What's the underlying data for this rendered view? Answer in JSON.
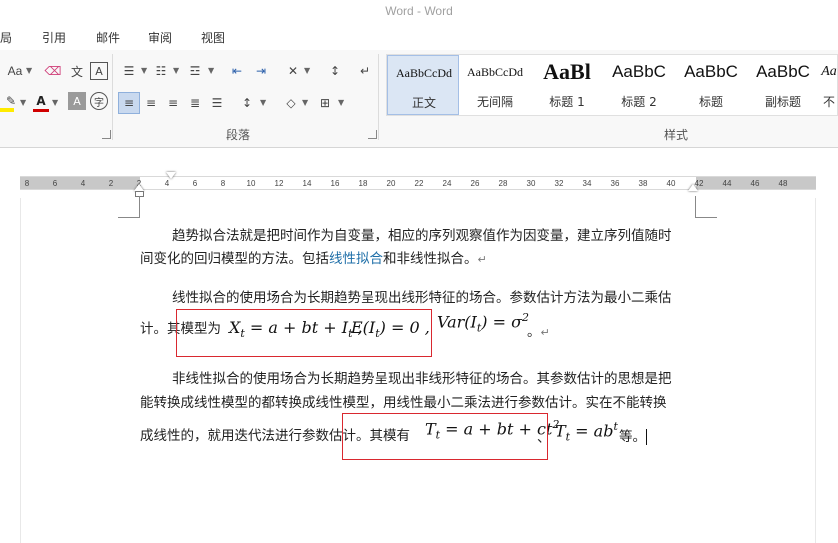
{
  "window": {
    "title": "Word - Word"
  },
  "menu_tabs": [
    "局",
    "引用",
    "邮件",
    "审阅",
    "视图"
  ],
  "ribbon": {
    "groups": {
      "paragraph": "段落",
      "styles": "样式"
    },
    "font_size_button": "Aa",
    "styles": [
      {
        "sample": "AaBbCcDd",
        "name": "正文",
        "selected": true
      },
      {
        "sample": "AaBbCcDd",
        "name": "无间隔"
      },
      {
        "sample": "AaBl",
        "name": "标题 1"
      },
      {
        "sample": "AaBbC",
        "name": "标题 2"
      },
      {
        "sample": "AaBbC",
        "name": "标题"
      },
      {
        "sample": "AaBbC",
        "name": "副标题"
      },
      {
        "sample": "Aa",
        "name": "不"
      }
    ]
  },
  "ruler": {
    "ticks": [
      "8",
      "6",
      "4",
      "2",
      "2",
      "4",
      "6",
      "8",
      "10",
      "12",
      "14",
      "16",
      "18",
      "20",
      "22",
      "24",
      "26",
      "28",
      "30",
      "32",
      "34",
      "36",
      "38",
      "40",
      "42",
      "44",
      "46",
      "48"
    ]
  },
  "document": {
    "p1": {
      "line1": "趋势拟合法就是把时间作为自变量，相应的序列观察值作为因变量，建立序列值随时",
      "line2a": "间变化的回归模型的方法。包括",
      "link": "线性拟合",
      "line2b": "和非线性拟合。"
    },
    "p2": {
      "line1": "线性拟合的使用场合为长期趋势呈现出线形特征的场合。参数估计方法为最小二乘估",
      "line2a": "计。其模型为",
      "eq1": "Xt = a + bt + It",
      "eq2": "E(It) = 0",
      "eq3": "Var(It) = σ2",
      "line2b": "。"
    },
    "p3": {
      "line1": "非线性拟合的使用场合为长期趋势呈现出非线形特征的场合。其参数估计的思想是把",
      "line2": "能转换成线性模型的都转换成线性模型，用线性最小二乘法进行参数估计。实在不能转换",
      "line3a": "成线性的，就用迭代法进行参数估计。其模有",
      "eq4": "Tt = a + bt + ct2",
      "sep": "、",
      "eq5": "Tt = abt",
      "line3b": "等。"
    },
    "paragraph_mark": "↵"
  }
}
